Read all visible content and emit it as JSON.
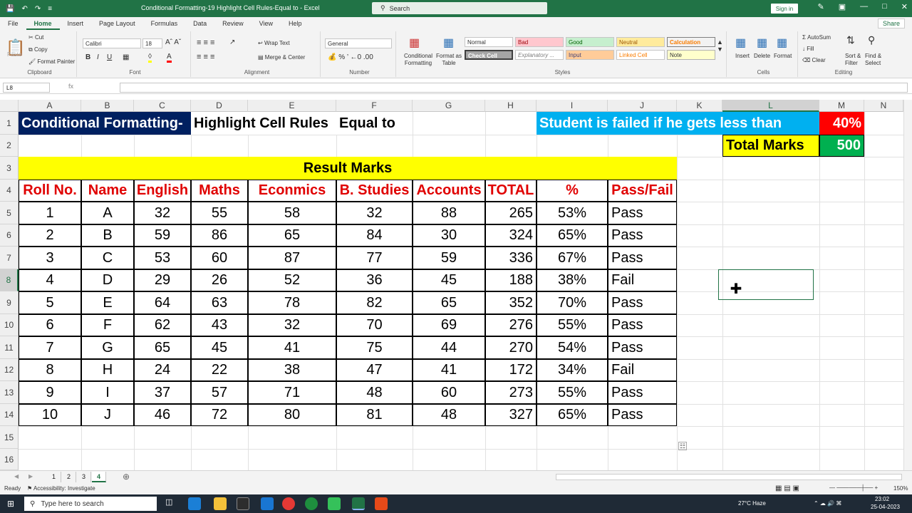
{
  "window": {
    "title": "Conditional Formatting-19 Highlight Cell Rules-Equal to  -  Excel",
    "search_placeholder": "Search",
    "signin": "Sign in",
    "share": "Share"
  },
  "menu_tabs": [
    "File",
    "Home",
    "Insert",
    "Page Layout",
    "Formulas",
    "Data",
    "Review",
    "View",
    "Help"
  ],
  "ribbon": {
    "clipboard": {
      "label": "Clipboard",
      "paste": "Paste",
      "cut": "Cut",
      "copy": "Copy",
      "format_painter": "Format Painter"
    },
    "font": {
      "label": "Font",
      "name": "Calibri",
      "size": "18"
    },
    "alignment": {
      "label": "Alignment",
      "wrap": "Wrap Text",
      "merge": "Merge & Center"
    },
    "number": {
      "label": "Number",
      "format": "General"
    },
    "styles": {
      "label": "Styles",
      "cond_fmt": "Conditional Formatting",
      "format_table": "Format as Table",
      "boxes": [
        "Normal",
        "Bad",
        "Good",
        "Neutral",
        "Calculation",
        "Check Cell",
        "Explanatory ...",
        "Input",
        "Linked Cell",
        "Note"
      ]
    },
    "cells": {
      "label": "Cells",
      "insert": "Insert",
      "delete": "Delete",
      "format": "Format"
    },
    "editing": {
      "label": "Editing",
      "autosum": "AutoSum",
      "fill": "Fill",
      "clear": "Clear",
      "sort": "Sort & Filter",
      "find": "Find & Select"
    }
  },
  "formula_bar": {
    "namebox": "L8",
    "fx": "fx",
    "value": ""
  },
  "columns": [
    "A",
    "B",
    "C",
    "D",
    "E",
    "F",
    "G",
    "H",
    "I",
    "J",
    "K",
    "L",
    "M",
    "N"
  ],
  "rows": [
    "1",
    "2",
    "3",
    "4",
    "5",
    "6",
    "7",
    "8",
    "9",
    "10",
    "11",
    "12",
    "13",
    "14",
    "15",
    "16"
  ],
  "sheet": {
    "title_a1": "Conditional Formatting-",
    "title_d1": "Highlight Cell Rules",
    "title_e1": "Equal to",
    "fail_note": "Student is failed if he gets less than",
    "fail_pct": "40%",
    "total_marks_label": "Total Marks",
    "total_marks_value": "500",
    "result_header": "Result Marks",
    "headers": [
      "Roll No.",
      "Name",
      "English",
      "Maths",
      "Econmics",
      "B. Studies",
      "Accounts",
      "TOTAL",
      "%",
      "Pass/Fail"
    ],
    "data": [
      [
        "1",
        "A",
        "32",
        "55",
        "58",
        "32",
        "88",
        "265",
        "53%",
        "Pass"
      ],
      [
        "2",
        "B",
        "59",
        "86",
        "65",
        "84",
        "30",
        "324",
        "65%",
        "Pass"
      ],
      [
        "3",
        "C",
        "53",
        "60",
        "87",
        "77",
        "59",
        "336",
        "67%",
        "Pass"
      ],
      [
        "4",
        "D",
        "29",
        "26",
        "52",
        "36",
        "45",
        "188",
        "38%",
        "Fail"
      ],
      [
        "5",
        "E",
        "64",
        "63",
        "78",
        "82",
        "65",
        "352",
        "70%",
        "Pass"
      ],
      [
        "6",
        "F",
        "62",
        "43",
        "32",
        "70",
        "69",
        "276",
        "55%",
        "Pass"
      ],
      [
        "7",
        "G",
        "65",
        "45",
        "41",
        "75",
        "44",
        "270",
        "54%",
        "Pass"
      ],
      [
        "8",
        "H",
        "24",
        "22",
        "38",
        "47",
        "41",
        "172",
        "34%",
        "Fail"
      ],
      [
        "9",
        "I",
        "37",
        "57",
        "71",
        "48",
        "60",
        "273",
        "55%",
        "Pass"
      ],
      [
        "10",
        "J",
        "46",
        "72",
        "80",
        "81",
        "48",
        "327",
        "65%",
        "Pass"
      ]
    ]
  },
  "sheet_tabs": [
    "1",
    "2",
    "3",
    "4"
  ],
  "status": {
    "ready": "Ready",
    "accessibility": "Accessibility: Investigate",
    "zoom": "150%"
  },
  "taskbar": {
    "search": "Type here to search",
    "weather": "27°C  Haze",
    "time": "23:02",
    "date": "25-04-2023"
  },
  "colors": {
    "excel_green": "#217346",
    "navy": "#002060",
    "yellow": "#ffff00",
    "cyan": "#00b0f0",
    "red": "#ff0000",
    "green": "#00b050",
    "header_red": "#e00000"
  }
}
